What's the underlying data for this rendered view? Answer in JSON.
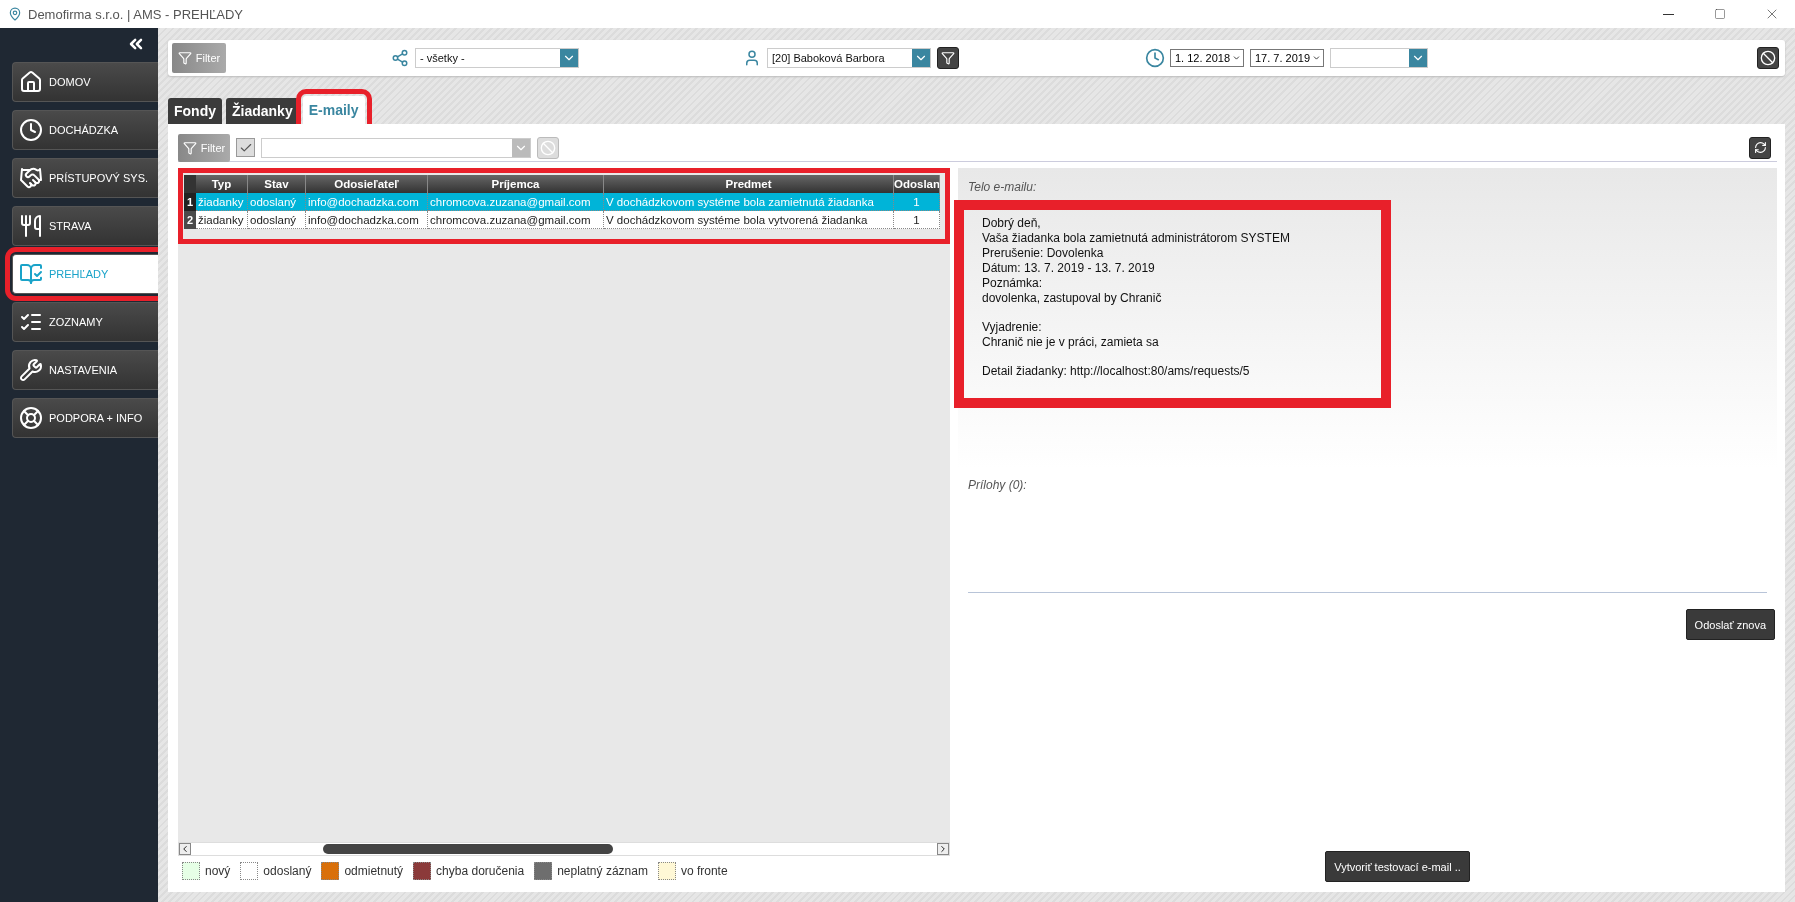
{
  "window": {
    "title": "Demofirma s.r.o. | AMS - PREHĽADY"
  },
  "sidebar": {
    "items": [
      {
        "label": "DOMOV",
        "selected": false,
        "highlighted": false
      },
      {
        "label": "DOCHÁDZKA",
        "selected": false,
        "highlighted": false
      },
      {
        "label": "PRÍSTUPOVÝ SYS.",
        "selected": false,
        "highlighted": false
      },
      {
        "label": "STRAVA",
        "selected": false,
        "highlighted": false
      },
      {
        "label": "PREHĽADY",
        "selected": true,
        "highlighted": true
      },
      {
        "label": "ZOZNAMY",
        "selected": false,
        "highlighted": false
      },
      {
        "label": "NASTAVENIA",
        "selected": false,
        "highlighted": false
      },
      {
        "label": "PODPORA + INFO",
        "selected": false,
        "highlighted": false
      }
    ]
  },
  "toolbar": {
    "filter_button": "Filter",
    "group_select": "- všetky -",
    "person_select": "[20] Baboková Barbora",
    "date_from": "1. 12. 2018",
    "date_to": "17. 7. 2019"
  },
  "tabs": [
    {
      "label": "Fondy",
      "selected": false,
      "highlighted": false
    },
    {
      "label": "Žiadanky",
      "selected": false,
      "highlighted": false
    },
    {
      "label": "E-maily",
      "selected": true,
      "highlighted": true
    }
  ],
  "subfilter": {
    "button": "Filter",
    "checked": true
  },
  "table": {
    "highlighted": true,
    "columns": [
      "Typ",
      "Stav",
      "Odosieľateľ",
      "Príjemca",
      "Predmet",
      "Odoslan"
    ],
    "rows": [
      {
        "number": "1",
        "selected": true,
        "cells": [
          "žiadanky",
          "odoslaný",
          "info@dochadzka.com",
          "chromcova.zuzana@gmail.com",
          "V dochádzkovom systéme bola zamietnutá žiadanka",
          "1"
        ]
      },
      {
        "number": "2",
        "selected": false,
        "cells": [
          "žiadanky",
          "odoslaný",
          "info@dochadzka.com",
          "chromcova.zuzana@gmail.com",
          "V dochádzkovom systéme bola vytvorená žiadanka",
          "1"
        ]
      }
    ]
  },
  "legend": [
    {
      "label": "nový",
      "color": "#e6ffe6"
    },
    {
      "label": "odoslaný",
      "color": "#ffffff"
    },
    {
      "label": "odmietnutý",
      "color": "#d9700a"
    },
    {
      "label": "chyba doručenia",
      "color": "#8b3a3a"
    },
    {
      "label": "neplatný záznam",
      "color": "#6e6e6e"
    },
    {
      "label": "vo fronte",
      "color": "#fff8d6"
    }
  ],
  "email": {
    "body_label": "Telo e-mailu:",
    "highlighted": true,
    "paragraphs": [
      [
        "Dobrý deň,",
        "Vaša žiadanka bola zamietnutá administrátorom SYSTEM",
        "Prerušenie: Dovolenka",
        "Dátum: 13. 7. 2019 - 13. 7. 2019",
        "Poznámka:",
        "dovolenka, zastupoval by Chranič"
      ],
      [
        "Vyjadrenie:",
        "Chranič nie je v práci, zamieta sa"
      ],
      [
        "Detail žiadanky: http://localhost:80/ams/requests/5"
      ]
    ],
    "attachments_label": "Prílohy (0):",
    "resend_button": "Odoslať znova",
    "test_button": "Vytvoriť testovací e-mail .."
  }
}
